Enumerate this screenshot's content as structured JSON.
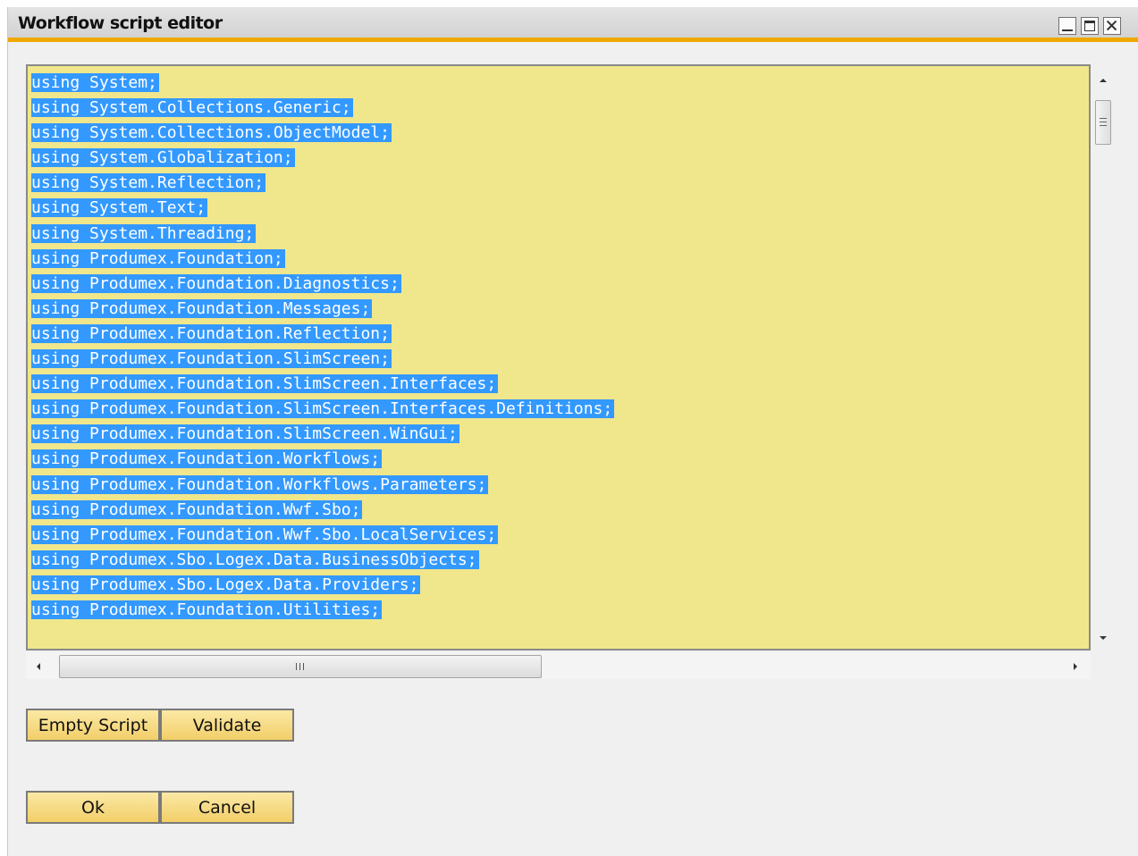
{
  "window": {
    "title": "Workflow script editor"
  },
  "editor": {
    "lines": [
      "using System;",
      "using System.Collections.Generic;",
      "using System.Collections.ObjectModel;",
      "using System.Globalization;",
      "using System.Reflection;",
      "using System.Text;",
      "using System.Threading;",
      "using Produmex.Foundation;",
      "using Produmex.Foundation.Diagnostics;",
      "using Produmex.Foundation.Messages;",
      "using Produmex.Foundation.Reflection;",
      "using Produmex.Foundation.SlimScreen;",
      "using Produmex.Foundation.SlimScreen.Interfaces;",
      "using Produmex.Foundation.SlimScreen.Interfaces.Definitions;",
      "using Produmex.Foundation.SlimScreen.WinGui;",
      "using Produmex.Foundation.Workflows;",
      "using Produmex.Foundation.Workflows.Parameters;",
      "using Produmex.Foundation.Wwf.Sbo;",
      "using Produmex.Foundation.Wwf.Sbo.LocalServices;",
      "using Produmex.Sbo.Logex.Data.BusinessObjects;",
      "using Produmex.Sbo.Logex.Data.Providers;",
      "using Produmex.Foundation.Utilities;"
    ],
    "selection_color": "#3399ff",
    "background_color": "#f0e68c"
  },
  "buttons": {
    "empty_script": "Empty Script",
    "validate": "Validate",
    "ok": "Ok",
    "cancel": "Cancel"
  },
  "colors": {
    "accent": "#f0a800",
    "button_top": "#fbe9a5",
    "button_bottom": "#f2ce68"
  },
  "icons": {
    "minimize": "minimize-icon",
    "maximize": "maximize-icon",
    "close": "close-icon",
    "scroll_up": "arrow-up-icon",
    "scroll_down": "arrow-down-icon",
    "scroll_left": "arrow-left-icon",
    "scroll_right": "arrow-right-icon"
  }
}
